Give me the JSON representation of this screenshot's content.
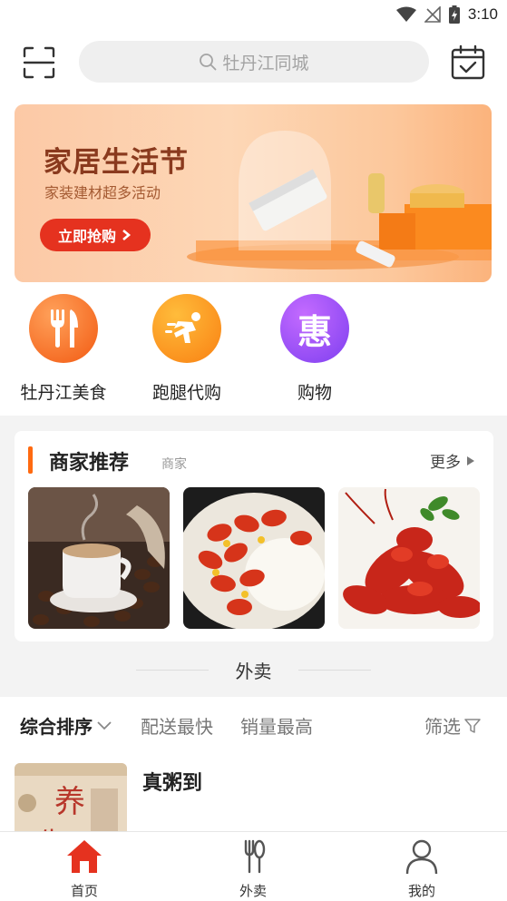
{
  "status_bar": {
    "time": "3:10"
  },
  "header": {
    "search_placeholder": "牡丹江同城"
  },
  "banner": {
    "title": "家居生活节",
    "subtitle": "家装建材超多活动",
    "cta": "立即抢购"
  },
  "quick_nav": [
    {
      "label": "牡丹江美食",
      "icon": "fork-knife-icon",
      "color": "#f7661a"
    },
    {
      "label": "跑腿代购",
      "icon": "runner-icon",
      "color": "#fb8a12"
    },
    {
      "label": "购物",
      "icon": "hui-icon",
      "color": "#9b4cf0",
      "glyph": "惠"
    }
  ],
  "merchants": {
    "title": "商家推荐",
    "subtitle": "商家",
    "more": "更多",
    "images": [
      "coffee-image",
      "crayfish-rice-image",
      "crayfish-image"
    ]
  },
  "takeout": {
    "label": "外卖"
  },
  "sort_bar": {
    "items": [
      "综合排序",
      "配送最快",
      "销量最高"
    ],
    "filter": "筛选"
  },
  "shops": [
    {
      "name": "真粥到"
    }
  ],
  "tabbar": {
    "items": [
      {
        "label": "首页",
        "icon": "home-icon",
        "active": true
      },
      {
        "label": "外卖",
        "icon": "utensils-icon",
        "active": false
      },
      {
        "label": "我的",
        "icon": "user-icon",
        "active": false
      }
    ]
  },
  "colors": {
    "accent": "#ff6a10",
    "active_tab": "#e5321f"
  }
}
